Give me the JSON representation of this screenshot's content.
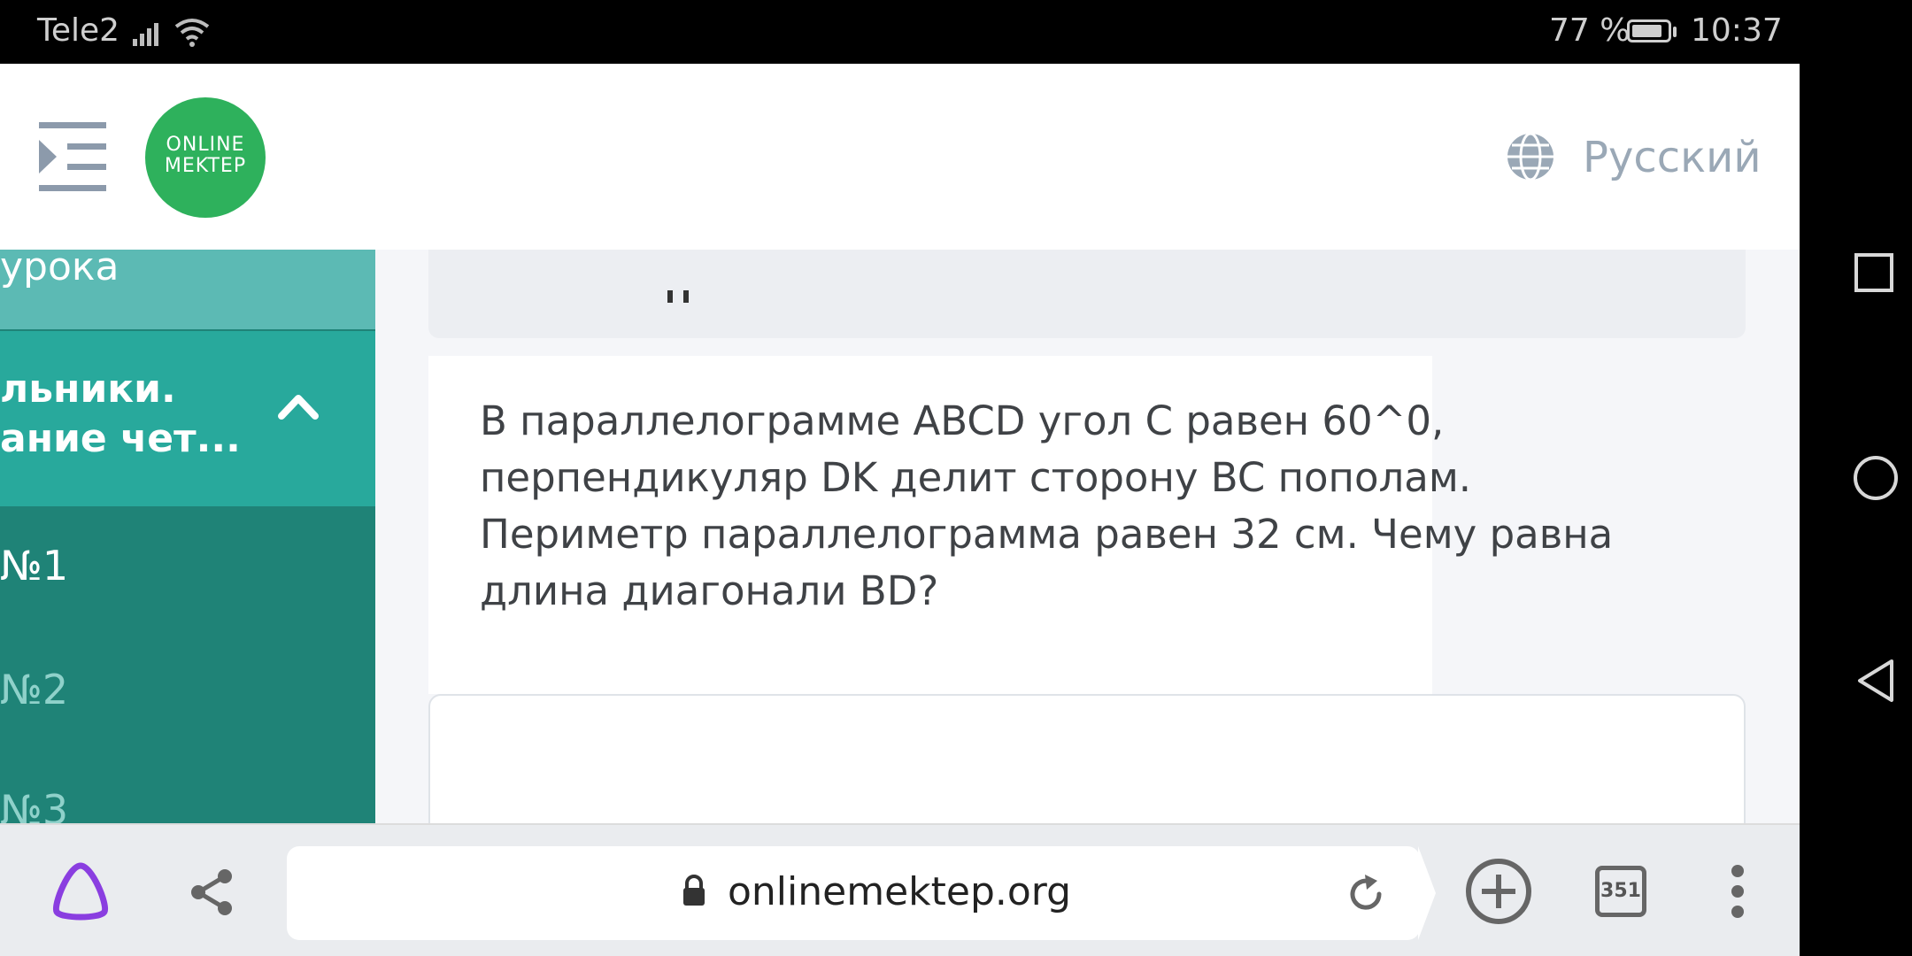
{
  "status_bar": {
    "carrier": "Tele2",
    "battery": "77 %",
    "time": "10:37"
  },
  "header": {
    "menu_icon": "menu-collapse-icon",
    "logo": {
      "line1": "ONLINE",
      "line2": "MEKTEP"
    },
    "language_icon": "globe-icon",
    "language": "Русский"
  },
  "sidebar": {
    "top_item": "урока",
    "active_section": {
      "line1": "льники.",
      "line2": "ание чет..."
    },
    "sub_items": [
      "№1",
      "№2",
      "№3"
    ]
  },
  "question": {
    "text": "В параллелограмме ABCD угол C равен 60^0, перпендикуляр DK делит сторону BC пополам. Периметр параллелограмма равен 32 см. Чему равна длина диагонали BD?"
  },
  "browser": {
    "url": "onlinemektep.org",
    "tab_count": "351"
  },
  "colors": {
    "logo_green": "#2eb15c",
    "sidebar_dark": "#1f8377",
    "sidebar_active": "#28a99c",
    "sidebar_light": "#5cbab4"
  }
}
